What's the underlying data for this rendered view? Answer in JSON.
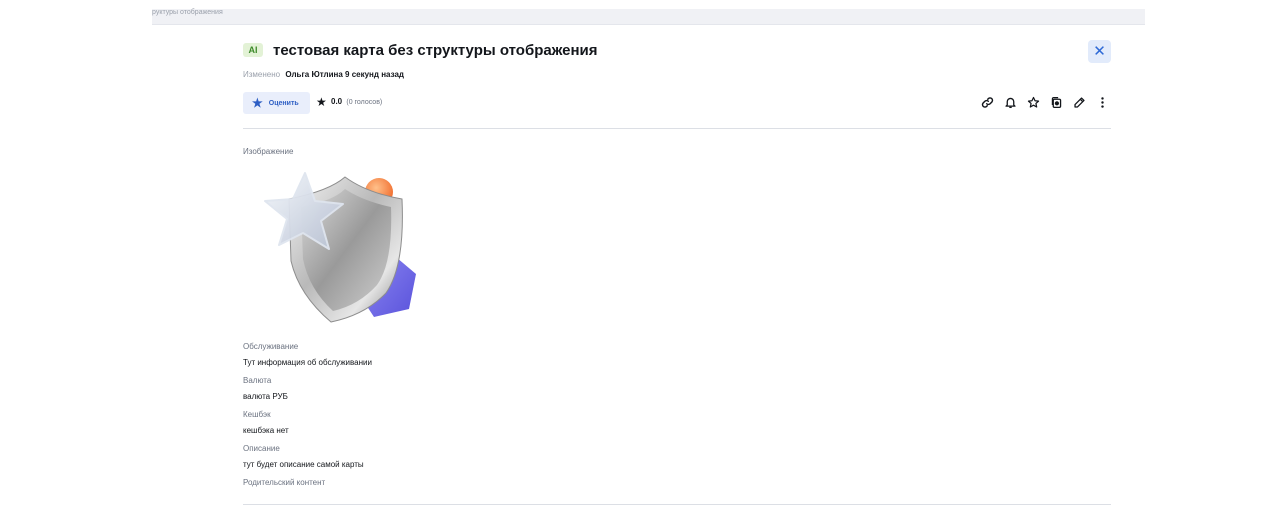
{
  "breadcrumb": "руктуры отображения",
  "card": {
    "badge": "AI",
    "title": "тестовая карта без структуры отображения",
    "modified_label": "Изменено",
    "modified_by": "Ольга Ютлина 9 секунд назад",
    "close_icon": "close-icon"
  },
  "rating": {
    "rate_button_label": "Оценить",
    "score": "0.0",
    "votes": "(0 голосов)"
  },
  "actions": [
    "link-icon",
    "bell-icon",
    "star-icon",
    "copy-icon",
    "edit-icon",
    "more-icon"
  ],
  "fields": {
    "image_label": "Изображение",
    "service_label": "Обслуживание",
    "service_value": "Тут информация об обслуживании",
    "currency_label": "Валюта",
    "currency_value": "валюта РУБ",
    "cashback_label": "Кешбэк",
    "cashback_value": "кешбэка нет",
    "description_label": "Описание",
    "description_value": "тут будет описание самой карты",
    "parent_label": "Родительский контент"
  },
  "colors": {
    "accent": "#2d69d6",
    "accent_bg": "#e2ebfb",
    "ai_badge_bg": "#e3f2d6",
    "ai_badge_fg": "#3d8a2a"
  }
}
